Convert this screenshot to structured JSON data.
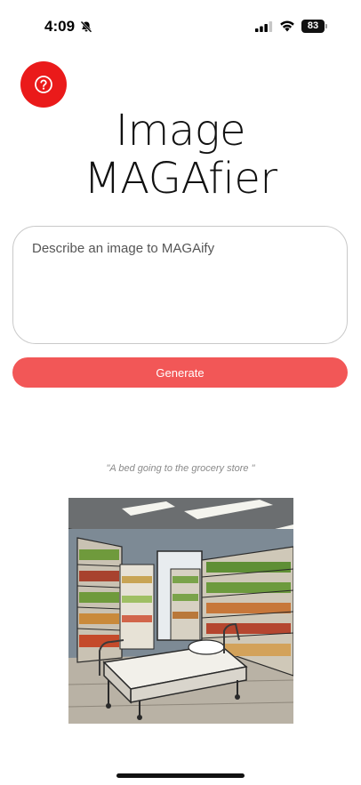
{
  "status_bar": {
    "time": "4:09",
    "battery_level": "83",
    "icons": [
      "bell-slash-icon",
      "cellular-signal-icon",
      "wifi-icon",
      "battery-icon"
    ]
  },
  "help_button": {
    "icon": "question-circle-icon",
    "color": "#ea1a1a"
  },
  "title": {
    "line1": "Image",
    "line2": "MAGAfier"
  },
  "prompt": {
    "placeholder": "Describe an image to MAGAify",
    "value": ""
  },
  "generate_button": {
    "label": "Generate",
    "color": "#f25757"
  },
  "result": {
    "caption": "\"A bed going to the grocery store \"",
    "image_subject": "comic-style illustration of a hospital bed on wheels in a grocery store aisle"
  }
}
